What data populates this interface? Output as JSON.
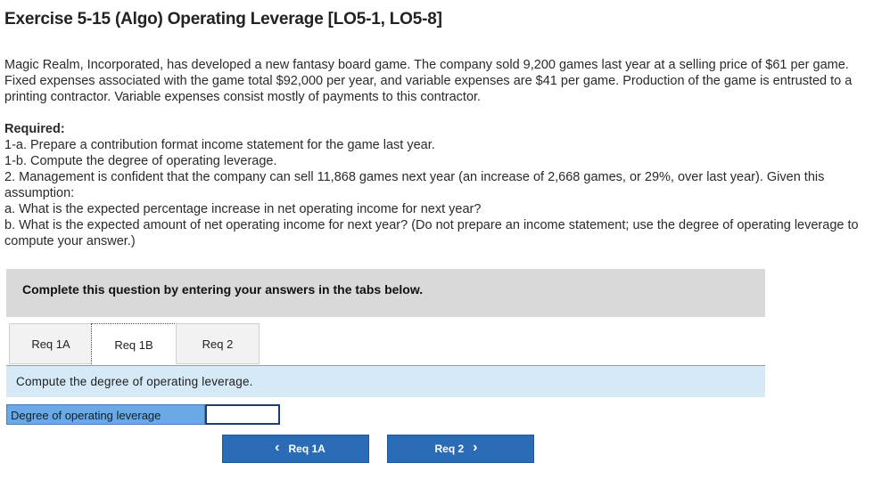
{
  "title": "Exercise 5-15 (Algo) Operating Leverage [LO5-1, LO5-8]",
  "intro": "Magic Realm, Incorporated, has developed a new fantasy board game. The company sold 9,200 games last year at a selling price of $61 per game. Fixed expenses associated with the game total $92,000 per year, and variable expenses are $41 per game. Production of the game is entrusted to a printing contractor. Variable expenses consist mostly of payments to this contractor.",
  "required": {
    "heading": "Required:",
    "lines": [
      "1-a. Prepare a contribution format income statement for the game last year.",
      "1-b. Compute the degree of operating leverage.",
      "2. Management is confident that the company can sell 11,868 games next year (an increase of 2,668 games, or 29%, over last year). Given this assumption:",
      "a. What is the expected percentage increase in net operating income for next year?",
      "b. What is the expected amount of net operating income for next year? (Do not prepare an income statement; use the degree of operating leverage to compute your answer.)"
    ]
  },
  "instructions": "Complete this question by entering your answers in the tabs below.",
  "tabs": [
    {
      "label": "Req 1A"
    },
    {
      "label": "Req 1B"
    },
    {
      "label": "Req 2"
    }
  ],
  "active_tab": "Req 1B",
  "prompt": "Compute the degree of operating leverage.",
  "answer_row": {
    "label": "Degree of operating leverage",
    "value": ""
  },
  "nav": {
    "prev_label": "Req 1A",
    "next_label": "Req 2",
    "prev_icon": "chevron-left-icon",
    "next_icon": "chevron-right-icon"
  },
  "colors": {
    "button_blue": "#2b6cb6",
    "label_blue": "#6aa8e6",
    "prompt_bg": "#d6e9f7",
    "instructions_bg": "#d9d9d9"
  }
}
